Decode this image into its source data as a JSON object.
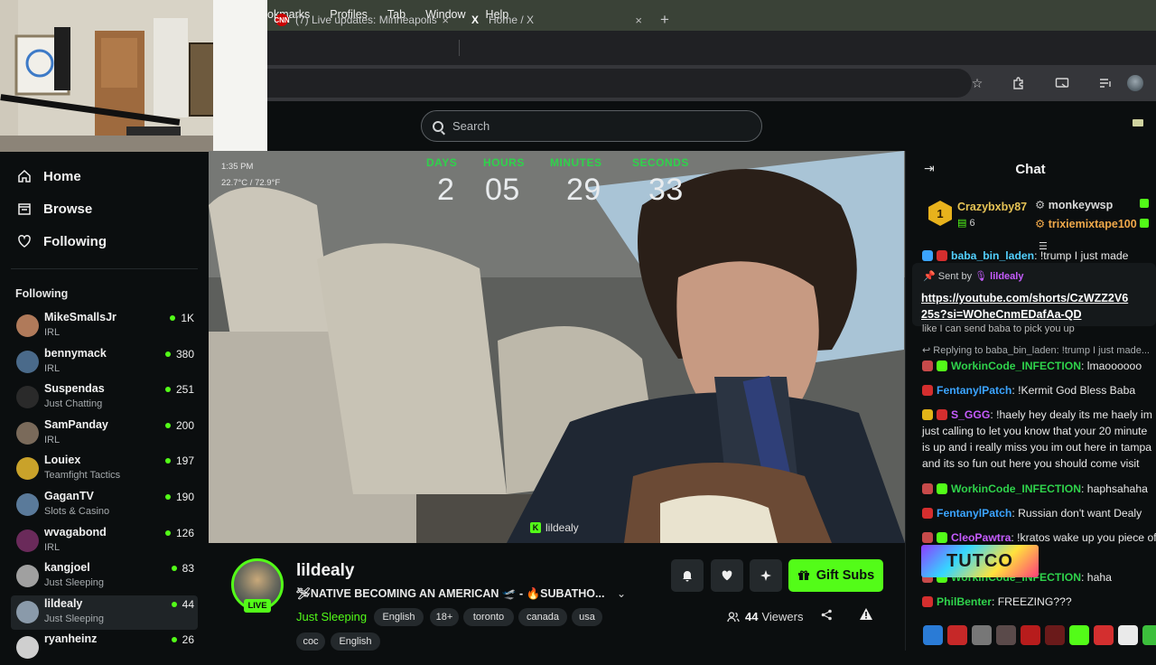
{
  "os_menu": {
    "items": [
      "okmarks",
      "Profiles",
      "Tab",
      "Window",
      "Help"
    ]
  },
  "browser": {
    "tabs": [
      {
        "favicon": "CNN",
        "title": "(7) Live updates: Minneapolis"
      },
      {
        "favicon": "X",
        "title": "Home / X"
      }
    ],
    "new_tab": "+",
    "close": "×",
    "toolbar_icons": [
      "star-icon",
      "extensions-icon",
      "cast-icon",
      "media-icon",
      "profile-icon"
    ]
  },
  "kick": {
    "search_placeholder": "Search"
  },
  "sidebar": {
    "nav": [
      {
        "label": "Home",
        "icon": "home-icon"
      },
      {
        "label": "Browse",
        "icon": "browse-icon"
      },
      {
        "label": "Following",
        "icon": "heart-icon"
      }
    ],
    "following_heading": "Following",
    "following": [
      {
        "name": "MikeSmallsJr",
        "category": "IRL",
        "viewers": "1K",
        "color": "#b07a5a"
      },
      {
        "name": "bennymack",
        "category": "IRL",
        "viewers": "380",
        "color": "#4a6a8a"
      },
      {
        "name": "Suspendas",
        "category": "Just Chatting",
        "viewers": "251",
        "color": "#2a2a2a"
      },
      {
        "name": "SamPanday",
        "category": "IRL",
        "viewers": "200",
        "color": "#7a6a5a"
      },
      {
        "name": "Louiex",
        "category": "Teamfight Tactics",
        "viewers": "197",
        "color": "#c9a22a"
      },
      {
        "name": "GaganTV",
        "category": "Slots & Casino",
        "viewers": "190",
        "color": "#5a7a9a"
      },
      {
        "name": "wvagabond",
        "category": "IRL",
        "viewers": "126",
        "color": "#6a2a5a"
      },
      {
        "name": "kangjoel",
        "category": "Just Sleeping",
        "viewers": "83",
        "color": "#a0a0a0"
      },
      {
        "name": "lildealy",
        "category": "Just Sleeping",
        "viewers": "44",
        "color": "#8a9aaa"
      },
      {
        "name": "ryanheinz",
        "category": "",
        "viewers": "26",
        "color": "#cfcfcf"
      }
    ]
  },
  "video": {
    "time": "1:35 PM",
    "weather": "22.7°C / 72.9°F",
    "countdown": [
      {
        "label": "DAYS",
        "value": "2"
      },
      {
        "label": "HOURS",
        "value": "05"
      },
      {
        "label": "MINUTES",
        "value": "29"
      },
      {
        "label": "SECONDS",
        "value": "33"
      }
    ],
    "watermark": "lildealy"
  },
  "stream": {
    "live_badge": "LIVE",
    "channel": "lildealy",
    "title": "🛩NATIVE BECOMING AN AMERICAN 🛫 - 🔥SUBATHO...",
    "category": "Just Sleeping",
    "tags": [
      "English",
      "18+",
      "toronto",
      "canada",
      "usa",
      "coc",
      "English"
    ],
    "gift_label": "Gift Subs",
    "viewers_count": "44",
    "viewers_label": "Viewers"
  },
  "chat": {
    "title": "Chat",
    "leaders": [
      {
        "rank": "1",
        "name": "Crazybxby87",
        "count": "6"
      },
      {
        "name": "monkeywsp"
      },
      {
        "name": "trixiemixtape100"
      }
    ],
    "cutoff_msg": {
      "user": "baba_bin_laden",
      "text": ": !trump I just made"
    },
    "pinned": {
      "sent_by_label": "Sent by",
      "sent_by_user": "lildealy",
      "link_line1": "https://youtube.com/shorts/CzWZZ2V6",
      "link_line2": "25s?si=WOheCnmEDafAa-QD"
    },
    "partial_line": "like I can send baba to pick you up",
    "reply_line": "Replying to baba_bin_laden: !trump I just made...",
    "messages": [
      {
        "user": "WorkinCode_INFECTION",
        "color": "#2fd24b",
        "text": ": lmaoooooo"
      },
      {
        "user": "FentanylPatch",
        "color": "#3ba4ff",
        "text": ": !Kermit God Bless Baba"
      },
      {
        "user": "S_GGG",
        "color": "#c65cff",
        "text": ": !haely hey dealy its me haely im"
      },
      {
        "user": "",
        "color": "#e8e8e8",
        "text": "just calling to let you know that your 20 minute"
      },
      {
        "user": "",
        "color": "#e8e8e8",
        "text": "is up and i really miss you im out here in tampa"
      },
      {
        "user": "",
        "color": "#e8e8e8",
        "text": "and its so fun out here you should come visit"
      },
      {
        "user": "WorkinCode_INFECTION",
        "color": "#2fd24b",
        "text": ": haphsahaha"
      },
      {
        "user": "FentanylPatch",
        "color": "#3ba4ff",
        "text": ": Russian don't want Dealy"
      },
      {
        "user": "CleoPawtra",
        "color": "#c65cff",
        "text": ": !kratos wake up you piece of"
      },
      {
        "user": "WorkinCode_INFECTION",
        "color": "#2fd24b",
        "text": ": haha"
      },
      {
        "user": "PhilBenter",
        "color": "#2fd24b",
        "text": ": FREEZING???"
      }
    ],
    "emote_text": "TUTCO"
  }
}
